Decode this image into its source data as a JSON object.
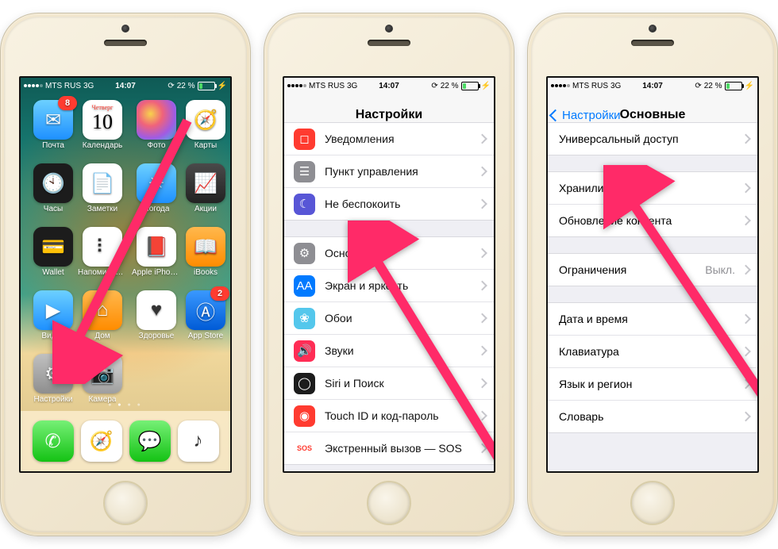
{
  "status": {
    "carrier": "MTS RUS",
    "net": "3G",
    "time": "14:07",
    "battery": "22 %"
  },
  "home": {
    "apps": [
      {
        "label": "Почта",
        "bg": "bg-lingrad-blue",
        "glyph": "✉",
        "badge": "8"
      },
      {
        "label": "Календарь",
        "bg": "bg-cal",
        "weekday": "Четверг",
        "day": "10"
      },
      {
        "label": "Фото",
        "bg": "bg-grad-colors",
        "glyph": ""
      },
      {
        "label": "Карты",
        "bg": "bg-white",
        "glyph": "🧭"
      },
      {
        "label": "Часы",
        "bg": "bg-black",
        "glyph": "🕙"
      },
      {
        "label": "Заметки",
        "bg": "bg-white",
        "glyph": "📄"
      },
      {
        "label": "Погода",
        "bg": "bg-lingrad-blue",
        "glyph": "☀"
      },
      {
        "label": "Акции",
        "bg": "bg-gradgray",
        "glyph": "📈"
      },
      {
        "label": "Wallet",
        "bg": "bg-black",
        "glyph": "💳"
      },
      {
        "label": "Напоминания",
        "bg": "bg-white",
        "glyph": "⠇"
      },
      {
        "label": "Apple iPhon…",
        "bg": "bg-white",
        "glyph": "📕"
      },
      {
        "label": "iBooks",
        "bg": "bg-orange",
        "glyph": "📖"
      },
      {
        "label": "Видео",
        "bg": "bg-lingrad-blue",
        "glyph": "▶"
      },
      {
        "label": "Дом",
        "bg": "bg-orange",
        "glyph": "⌂"
      },
      {
        "label": "Здоровье",
        "bg": "bg-white",
        "glyph": "♥"
      },
      {
        "label": "App Store",
        "bg": "bg-blue",
        "glyph": "Ⓐ",
        "badge": "2"
      },
      {
        "label": "Настройки",
        "bg": "bg-gray",
        "glyph": "⚙"
      },
      {
        "label": "Камера",
        "bg": "bg-camera",
        "glyph": "📷"
      }
    ],
    "dock": [
      {
        "name": "phone",
        "bg": "bg-green",
        "glyph": "✆"
      },
      {
        "name": "safari",
        "bg": "bg-white",
        "glyph": "🧭"
      },
      {
        "name": "messages",
        "bg": "bg-green",
        "glyph": "💬"
      },
      {
        "name": "music",
        "bg": "bg-white",
        "glyph": "♪"
      }
    ]
  },
  "settings": {
    "title": "Настройки",
    "groups": [
      [
        {
          "label": "Уведомления",
          "iconbg": "#ff3b30",
          "glyph": "◻"
        },
        {
          "label": "Пункт управления",
          "iconbg": "#8e8e93",
          "glyph": "☰"
        },
        {
          "label": "Не беспокоить",
          "iconbg": "#5856d6",
          "glyph": "☾"
        }
      ],
      [
        {
          "label": "Основные",
          "iconbg": "#8e8e93",
          "glyph": "⚙"
        },
        {
          "label": "Экран и яркость",
          "iconbg": "#007aff",
          "glyph": "AA"
        },
        {
          "label": "Обои",
          "iconbg": "#54c7ec",
          "glyph": "❀"
        },
        {
          "label": "Звуки",
          "iconbg": "#ff2d55",
          "glyph": "🔊"
        },
        {
          "label": "Siri и Поиск",
          "iconbg": "#1c1c1c",
          "glyph": "◯"
        },
        {
          "label": "Touch ID и код-пароль",
          "iconbg": "#ff3b30",
          "glyph": "◉"
        },
        {
          "label": "Экстренный вызов — SOS",
          "iconbg": "#ffffff",
          "glyph": "SOS",
          "txtclr": "#ff3b30"
        }
      ]
    ]
  },
  "general": {
    "back": "Настройки",
    "title": "Основные",
    "groups": [
      [
        {
          "label": "Универсальный доступ"
        }
      ],
      [
        {
          "label": "Хранилище iPhone"
        },
        {
          "label": "Обновление контента"
        }
      ],
      [
        {
          "label": "Ограничения",
          "detail": "Выкл."
        }
      ],
      [
        {
          "label": "Дата и время"
        },
        {
          "label": "Клавиатура"
        },
        {
          "label": "Язык и регион"
        },
        {
          "label": "Словарь"
        }
      ]
    ]
  }
}
